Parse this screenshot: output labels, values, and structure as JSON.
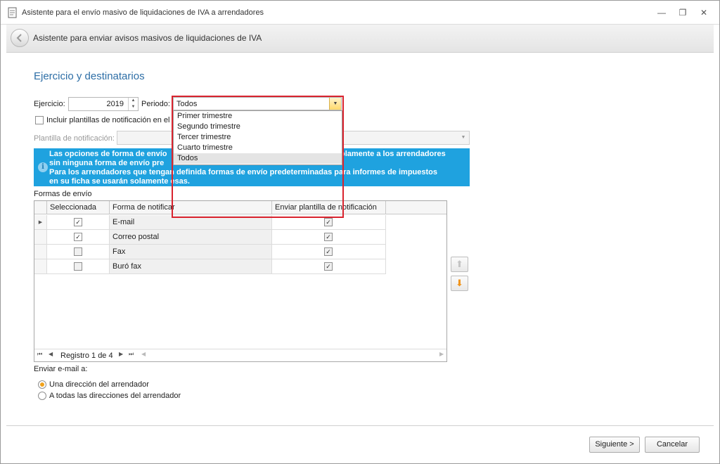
{
  "window": {
    "title": "Asistente para el envío masivo de liquidaciones de IVA a arrendadores",
    "icons": {
      "app": "document-icon",
      "minimize": "minimize-icon",
      "maximize": "maximize-icon",
      "close": "close-icon"
    }
  },
  "header": {
    "title": "Asistente para enviar avisos masivos de liquidaciones de IVA"
  },
  "section": {
    "title": "Ejercicio y destinatarios"
  },
  "form": {
    "ejercicio_label": "Ejercicio:",
    "ejercicio_value": "2019",
    "periodo_label": "Periodo:",
    "periodo_value": "Todos",
    "periodo_options": [
      "Primer trimestre",
      "Segundo trimestre",
      "Tercer trimestre",
      "Cuarto trimestre",
      "Todos"
    ],
    "incluir_label": "Incluir plantillas de notificación en el e",
    "plantilla_label": "Plantilla de notificación:",
    "plantilla_value": ""
  },
  "info": {
    "line1_left": "Las opciones de forma de envío",
    "line1_right": "olamente a los arrendadores",
    "line2_left": "sin ninguna forma de envío pre",
    "line3": "Para los arrendadores que tengan definida formas de envío predeterminadas para informes de impuestos",
    "line4": "en su ficha se usarán solamente esas."
  },
  "grid": {
    "caption": "Formas de envío",
    "columns": [
      "Seleccionada",
      "Forma de notificar",
      "Enviar plantilla de notificación"
    ],
    "rows": [
      {
        "selected": true,
        "forma": "E-mail",
        "enviar": true
      },
      {
        "selected": true,
        "forma": "Correo postal",
        "enviar": true
      },
      {
        "selected": false,
        "forma": "Fax",
        "enviar": true
      },
      {
        "selected": false,
        "forma": "Buró fax",
        "enviar": true
      }
    ],
    "navigator_text": "Registro 1 de 4"
  },
  "email": {
    "label": "Enviar e-mail a:",
    "options": [
      "Una dirección del arrendador",
      "A todas las direcciones del arrendador"
    ],
    "selected_index": 0
  },
  "buttons": {
    "next": "Siguiente >",
    "cancel": "Cancelar"
  },
  "colors": {
    "accent": "#2d6ea6",
    "info_bg": "#1fa2df",
    "highlight": "#d9232e",
    "radio": "#f0a21c"
  }
}
